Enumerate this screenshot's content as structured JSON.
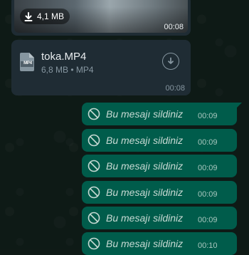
{
  "video_message": {
    "size_label": "4,1 MB",
    "time": "00:08",
    "download_icon": "download-arrow-icon"
  },
  "file_message": {
    "file_type_icon": "MP4",
    "file_name": "toka.MP4",
    "meta": "6,8 MB • MP4",
    "time": "00:08",
    "download_icon": "download-circle-icon"
  },
  "deleted_messages": [
    {
      "text": "Bu mesajı sildiniz",
      "time": "00:09"
    },
    {
      "text": "Bu mesajı sildiniz",
      "time": "00:09"
    },
    {
      "text": "Bu mesajı sildiniz",
      "time": "00:09"
    },
    {
      "text": "Bu mesajı sildiniz",
      "time": "00:09"
    },
    {
      "text": "Bu mesajı sildiniz",
      "time": "00:09"
    },
    {
      "text": "Bu mesajı sildiniz",
      "time": "00:10"
    }
  ],
  "colors": {
    "background": "#0e1a16",
    "incoming_bubble": "#1f2c34",
    "outgoing_bubble": "#005c4b"
  }
}
